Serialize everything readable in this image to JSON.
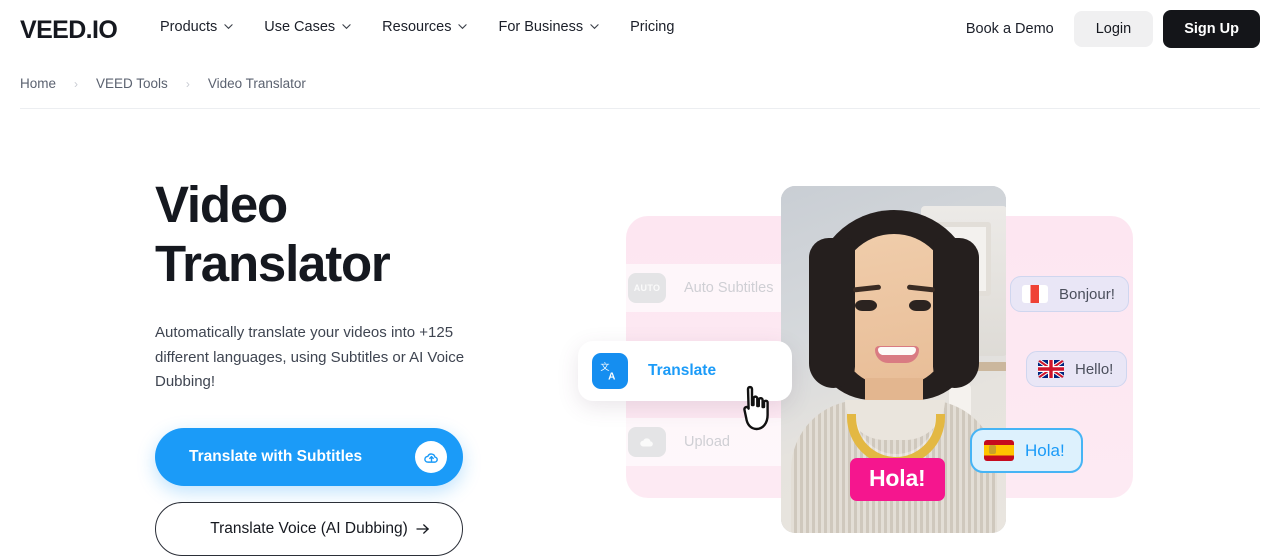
{
  "header": {
    "logo": "VEED.IO",
    "nav": [
      {
        "label": "Products",
        "has_chevron": true,
        "icon": "chevron-down-icon"
      },
      {
        "label": "Use Cases",
        "has_chevron": true,
        "icon": "chevron-down-icon"
      },
      {
        "label": "Resources",
        "has_chevron": true,
        "icon": "chevron-down-icon"
      },
      {
        "label": "For Business",
        "has_chevron": true,
        "icon": "chevron-down-icon"
      },
      {
        "label": "Pricing",
        "has_chevron": false,
        "icon": ""
      }
    ],
    "book_demo": "Book a Demo",
    "login": "Login",
    "signup": "Sign Up"
  },
  "breadcrumb": {
    "items": [
      "Home",
      "VEED Tools",
      "Video Translator"
    ],
    "separator": "›"
  },
  "hero": {
    "title_line1": "Video",
    "title_line2": "Translator",
    "subtitle": "Automatically translate your videos into +125 different languages, using Subtitles or AI Voice Dubbing!",
    "primary_cta": "Translate with Subtitles",
    "primary_cta_icon": "cloud-upload-icon",
    "secondary_cta": "Translate Voice (AI Dubbing)",
    "secondary_cta_icon": "arrow-right-icon"
  },
  "illustration": {
    "rows": [
      {
        "badge": "AUTO",
        "label": "Auto Subtitles",
        "icon": "auto-subtitles-icon"
      },
      {
        "badge": "",
        "label": "Upload",
        "icon": "cloud-upload-icon"
      }
    ],
    "translate_card": {
      "label": "Translate",
      "icon": "translate-icon",
      "cursor": "hand-pointer-cursor"
    },
    "subtitle_badge": "Hola!",
    "chips": [
      {
        "label": "Bonjour!",
        "flag": "flag-france-icon"
      },
      {
        "label": "Hello!",
        "flag": "flag-uk-icon"
      },
      {
        "label": "Hola!",
        "flag": "flag-spain-icon"
      }
    ]
  },
  "colors": {
    "accent_blue": "#1b9bf8",
    "dark": "#141519",
    "pink_panel": "#fce3ef",
    "hot_pink": "#f5168e",
    "chip_lavender": "#e9e6f6",
    "chip_blue": "#ddf1fd"
  }
}
